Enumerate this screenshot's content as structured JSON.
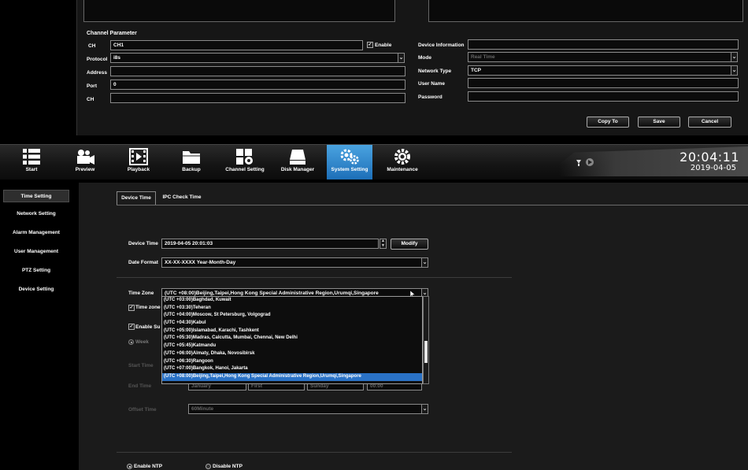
{
  "channel_dialog": {
    "group_title": "Channel Parameter",
    "ch_label": "CH",
    "ch_value": "CH1",
    "enable_label": "Enable",
    "enable_checked": true,
    "protocol_label": "Protocol",
    "protocol_value": "i8s",
    "address_label": "Address",
    "address_value": "",
    "port_label": "Port",
    "port_value": "0",
    "ch2_label": "CH",
    "ch2_value": "",
    "device_info_label": "Device Information",
    "device_info_value": "",
    "mode_label": "Mode",
    "mode_value": "Real Time",
    "network_type_label": "Network Type",
    "network_type_value": "TCP",
    "username_label": "User Name",
    "username_value": "",
    "password_label": "Password",
    "password_value": "",
    "copy_to": "Copy To",
    "save": "Save",
    "cancel": "Cancel"
  },
  "toolbar": {
    "items": [
      {
        "label": "Start",
        "icon": "start-icon"
      },
      {
        "label": "Preview",
        "icon": "preview-icon"
      },
      {
        "label": "Playback",
        "icon": "playback-icon"
      },
      {
        "label": "Backup",
        "icon": "backup-icon"
      },
      {
        "label": "Channel Setting",
        "icon": "channel-setting-icon"
      },
      {
        "label": "Disk Manager",
        "icon": "disk-manager-icon"
      },
      {
        "label": "System Setting",
        "icon": "system-setting-icon"
      },
      {
        "label": "Maintenance",
        "icon": "maintenance-icon"
      }
    ],
    "active_index": 6,
    "active_color": "#2f86cf",
    "clock_time": "20:04:11",
    "clock_date": "2019-04-05"
  },
  "left_menu": {
    "items": [
      "Time Setting",
      "Network Setting",
      "Alarm Management",
      "User Management",
      "PTZ Setting",
      "Device Setting"
    ],
    "active_index": 0
  },
  "main": {
    "tabs": [
      "Device Time",
      "IPC Check Time"
    ],
    "active_tab": 0,
    "device_time_label": "Device Time",
    "device_time_value": "2019-04-05 20:01:03",
    "modify": "Modify",
    "date_format_label": "Date Format",
    "date_format_value": "XX-XX-XXXX Year-Month-Day",
    "time_zone_label": "Time Zone",
    "time_zone_value": "(UTC +08:00)Beijing,Taipei,Hong Kong Special Administrative Region,Urumqi,Singapore",
    "time_zone_checkbox_label": "Time zone",
    "enable_dst_label": "Enable Su",
    "week_label": "Week",
    "start_time_label": "Start Time",
    "end_time_label": "End Time",
    "end_month": "January",
    "end_week": "First",
    "end_day": "Sunday",
    "end_time": "00:00",
    "offset_time_label": "Offset Time",
    "offset_time_value": "60Minute",
    "enable_ntp": "Enable NTP",
    "disable_ntp": "Disable NTP",
    "tz_options": [
      "(UTC +03:00)Baghdad, Kuwait",
      "(UTC +03:30)Teheran",
      "(UTC +04:00)Moscow, St Petersburg, Volgograd",
      "(UTC +04:30)Kabul",
      "(UTC +05:00)Islamabad, Karachi, Tashkent",
      "(UTC +05:30)Madras, Calcutta, Mumbai, Chennai, New Delhi",
      "(UTC +05:45)Katmandu",
      "(UTC +06:00)Almaty, Dhaka, Novosibirsk",
      "(UTC +06:30)Rangoon",
      "(UTC +07:00)Bangkok, Hanoi, Jakarta",
      "(UTC +08:00)Beijing,Taipei,Hong Kong Special Administrative Region,Urumqi,Singapore"
    ],
    "tz_selected_index": 10,
    "selection_color": "#2a72c6"
  }
}
